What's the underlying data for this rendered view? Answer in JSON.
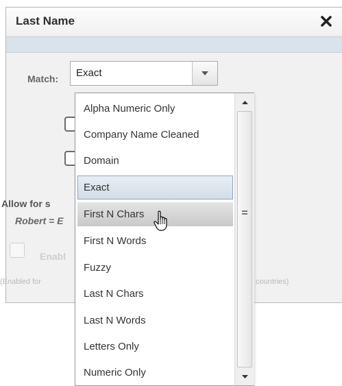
{
  "dialog": {
    "title": "Last Name",
    "match_label": "Match:",
    "match_value": "Exact",
    "allow_text": "Allow for s",
    "example_text": "Robert = E",
    "enable_text": "Enabl",
    "note_left": "(Enabled for",
    "note_right": "countries)"
  },
  "dropdown": {
    "items": [
      {
        "label": "Alpha Numeric Only"
      },
      {
        "label": "Company Name Cleaned"
      },
      {
        "label": "Domain"
      },
      {
        "label": "Exact",
        "state": "selected"
      },
      {
        "label": "First N Chars",
        "state": "hover"
      },
      {
        "label": "First N Words"
      },
      {
        "label": "Fuzzy"
      },
      {
        "label": "Last N Chars"
      },
      {
        "label": "Last N Words"
      },
      {
        "label": "Letters Only"
      },
      {
        "label": "Numeric Only"
      }
    ]
  },
  "icons": {
    "close": "close-x-icon",
    "dropdown_arrow": "chevron-down-icon",
    "scroll_up": "scroll-up-arrow-icon",
    "scroll_down": "scroll-down-arrow-icon",
    "cursor": "hand-pointer-cursor-icon"
  },
  "colors": {
    "band": "#d9e3ec",
    "selected_border": "#8ea5bb"
  }
}
